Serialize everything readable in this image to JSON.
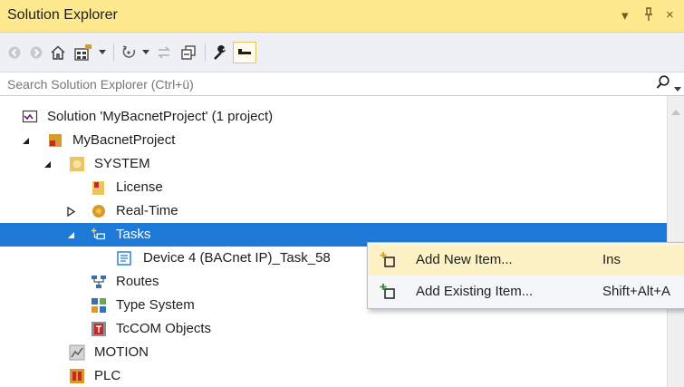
{
  "panel": {
    "title": "Solution Explorer",
    "controls": {
      "dropdown": "▾",
      "pin": "ᚏ",
      "close": "×"
    }
  },
  "toolbar": {
    "items": [
      "back-icon",
      "forward-icon",
      "home-icon",
      "switch-views-icon",
      "dropdown",
      "pending-changes-filter-icon",
      "dropdown",
      "sync-icon",
      "collapse-all-icon",
      "properties-icon",
      "preview-icon"
    ]
  },
  "search": {
    "placeholder": "Search Solution Explorer (Ctrl+ü)",
    "value": ""
  },
  "tree": {
    "items": [
      {
        "label": "Solution 'MyBacnetProject' (1 project)",
        "level": 0,
        "expanded": null,
        "icon": "solution-icon"
      },
      {
        "label": "MyBacnetProject",
        "level": 1,
        "expanded": true,
        "icon": "project-icon"
      },
      {
        "label": "SYSTEM",
        "level": 2,
        "expanded": true,
        "icon": "system-icon"
      },
      {
        "label": "License",
        "level": 3,
        "expanded": null,
        "icon": "license-icon"
      },
      {
        "label": "Real-Time",
        "level": 3,
        "expanded": false,
        "icon": "realtime-icon"
      },
      {
        "label": "Tasks",
        "level": 3,
        "expanded": true,
        "icon": "tasks-icon",
        "selected": true
      },
      {
        "label": "Device 4 (BACnet IP)_Task_58",
        "level": 4,
        "expanded": null,
        "icon": "task-icon"
      },
      {
        "label": "Routes",
        "level": 3,
        "expanded": null,
        "icon": "routes-icon"
      },
      {
        "label": "Type System",
        "level": 3,
        "expanded": null,
        "icon": "type-system-icon"
      },
      {
        "label": "TcCOM Objects",
        "level": 3,
        "expanded": null,
        "icon": "tccom-icon"
      },
      {
        "label": "MOTION",
        "level": 2,
        "expanded": null,
        "icon": "motion-icon"
      },
      {
        "label": "PLC",
        "level": 2,
        "expanded": null,
        "icon": "plc-icon"
      }
    ]
  },
  "context_menu": {
    "items": [
      {
        "label": "Add New Item...",
        "shortcut": "Ins",
        "icon": "add-new-item-icon",
        "highlighted": true
      },
      {
        "label": "Add Existing Item...",
        "shortcut": "Shift+Alt+A",
        "icon": "add-existing-item-icon",
        "highlighted": false
      }
    ]
  },
  "colors": {
    "title_bar": "#ffe98f",
    "selection": "#1e7ad6",
    "menu_hover": "#fdf2c6"
  }
}
